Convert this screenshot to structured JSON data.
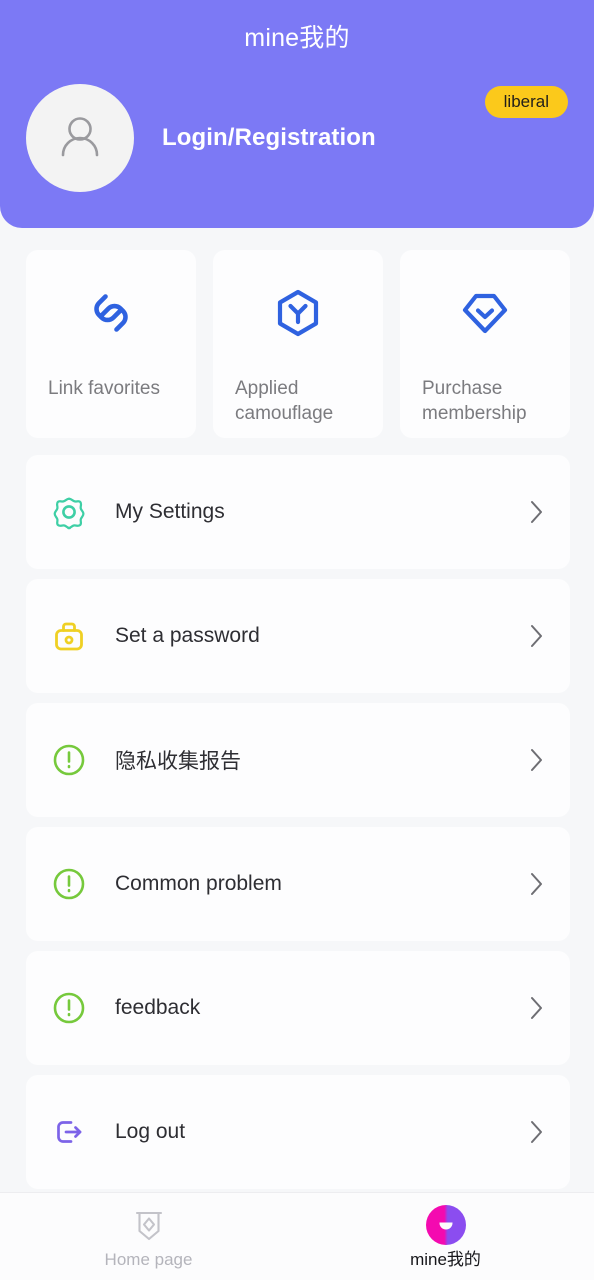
{
  "header": {
    "title": "mine我的",
    "login_label": "Login/Registration",
    "badge_label": "liberal",
    "avatar_icon": "user-avatar-icon",
    "background_color": "#7c79f5",
    "badge_color": "#fbc91b"
  },
  "quick_cards": [
    {
      "label": "Link favorites",
      "icon": "link-chain-icon",
      "icon_color": "#2f62e0"
    },
    {
      "label": "Applied camouflage",
      "icon": "hexagon-y-icon",
      "icon_color": "#2f62e0"
    },
    {
      "label": "Purchase membership",
      "icon": "shield-check-icon",
      "icon_color": "#2f62e0"
    }
  ],
  "list_items": [
    {
      "label": "My Settings",
      "icon": "gear-flower-icon",
      "icon_color": "#3ecfa5"
    },
    {
      "label": "Set a password",
      "icon": "padlock-icon",
      "icon_color": "#efd024"
    },
    {
      "label": "隐私收集报告",
      "icon": "exclamation-circle-icon",
      "icon_color": "#76c93c"
    },
    {
      "label": "Common problem",
      "icon": "exclamation-circle-icon",
      "icon_color": "#76c93c"
    },
    {
      "label": "feedback",
      "icon": "exclamation-circle-icon",
      "icon_color": "#76c93c"
    },
    {
      "label": "Log out",
      "icon": "logout-arrow-icon",
      "icon_color": "#7c63e8"
    }
  ],
  "chevron_icon": "chevron-right-icon",
  "bottom_nav": [
    {
      "label": "Home page",
      "icon": "shield-diamond-icon",
      "active": false
    },
    {
      "label": "mine我的",
      "icon": "mine-circle-icon",
      "active": true
    }
  ]
}
